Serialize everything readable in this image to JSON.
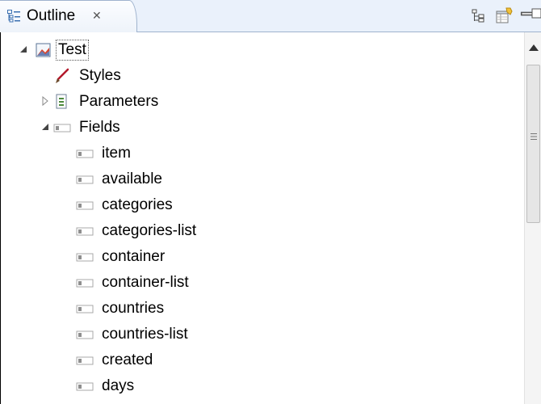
{
  "view": {
    "tab_title": "Outline",
    "close_glyph": "✕"
  },
  "toolbar": {
    "icons": [
      "tree-hierarchy-icon",
      "view-menu-icon",
      "minimize-icon",
      "maximize-icon"
    ]
  },
  "tree": {
    "root": {
      "label": "Test",
      "icon": "report-icon",
      "expanded": true
    },
    "children": [
      {
        "label": "Styles",
        "icon": "brush-icon",
        "twisty": "none"
      },
      {
        "label": "Parameters",
        "icon": "parameters-icon",
        "twisty": "collapsed"
      },
      {
        "label": "Fields",
        "icon": "field-icon",
        "twisty": "expanded"
      }
    ],
    "fields": [
      "item",
      "available",
      "categories",
      "categories-list",
      "container",
      "container-list",
      "countries",
      "countries-list",
      "created",
      "days"
    ]
  },
  "colors": {
    "title_bar": "#eaf1fb",
    "tab_border": "#9fb3ce",
    "selection_outline": "#555555"
  }
}
